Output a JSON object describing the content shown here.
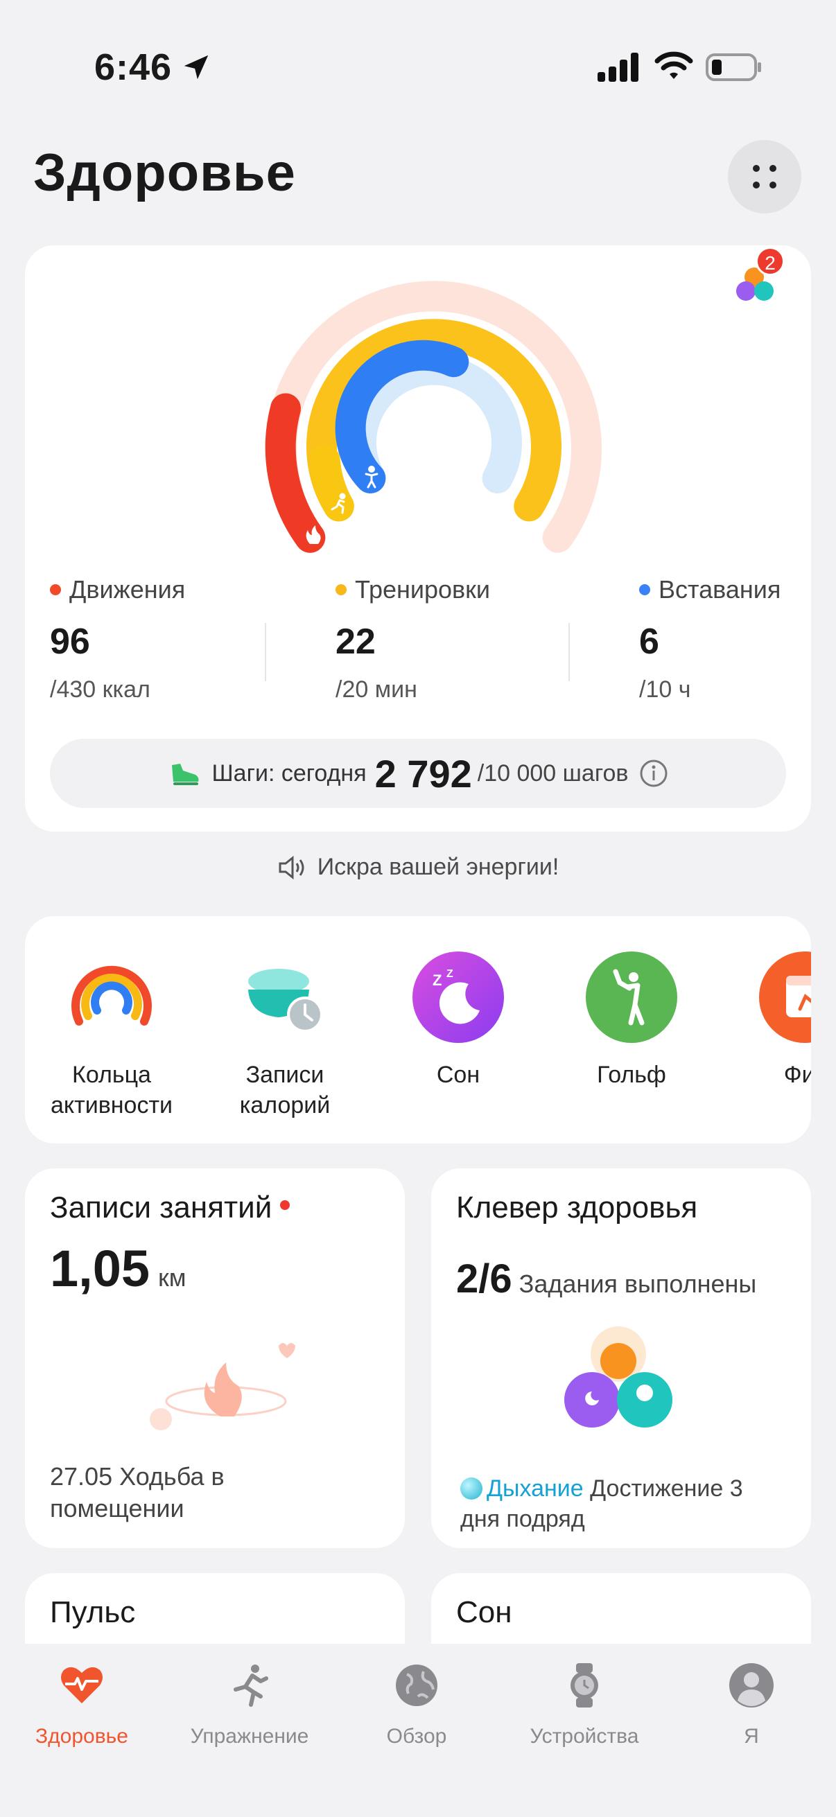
{
  "status": {
    "time": "6:46"
  },
  "header": {
    "title": "Здоровье",
    "notification_count": "2"
  },
  "activity": {
    "metrics": [
      {
        "label": "Движения",
        "value": "96",
        "goal": "/430 ккал",
        "color": "#f04a2a"
      },
      {
        "label": "Тренировки",
        "value": "22",
        "goal": "/20 мин",
        "color": "#f7b91a"
      },
      {
        "label": "Вставания",
        "value": "6",
        "goal": "/10 ч",
        "color": "#3b82f6"
      }
    ],
    "progress": {
      "move": 0.223,
      "exercise": 1.0,
      "stand": 0.6
    },
    "steps": {
      "prefix": "Шаги: сегодня",
      "value": "2 792",
      "goal": "/10 000 шагов"
    }
  },
  "motto": "Искра вашей энергии!",
  "shortcuts": [
    {
      "label": "Кольца\nактивности",
      "icon": "activity-rings-icon"
    },
    {
      "label": "Записи\nкалорий",
      "icon": "calorie-bowl-icon"
    },
    {
      "label": "Сон",
      "icon": "sleep-moon-icon"
    },
    {
      "label": "Гольф",
      "icon": "golf-icon"
    },
    {
      "label": "Фит",
      "icon": "fitness-calendar-icon"
    }
  ],
  "records": {
    "title": "Записи занятий",
    "value": "1,05",
    "unit": "км",
    "desc": "27.05 Ходьба в помещении"
  },
  "clover": {
    "title": "Клевер здоровья",
    "value": "2/6",
    "sub": "Задания выполнены",
    "highlight": "Дыхание",
    "desc": "Достижение 3 дня подряд"
  },
  "pulse": {
    "title": "Пульс"
  },
  "sleep": {
    "title": "Сон"
  },
  "nav": [
    {
      "label": "Здоровье",
      "icon": "heart-pulse-icon",
      "active": true
    },
    {
      "label": "Упражнение",
      "icon": "runner-icon"
    },
    {
      "label": "Обзор",
      "icon": "globe-icon"
    },
    {
      "label": "Устройства",
      "icon": "watch-icon"
    },
    {
      "label": "Я",
      "icon": "profile-icon"
    }
  ]
}
